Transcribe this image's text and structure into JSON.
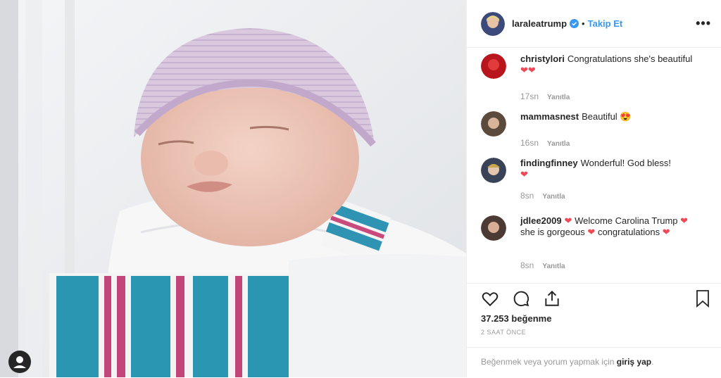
{
  "post": {
    "username": "laraleatrump",
    "follow_label": "Takip Et",
    "dot": "•",
    "likes": "37.253 beğenme",
    "time_ago": "2 SAAT ÖNCE",
    "login_text": "Beğenmek veya yorum yapmak için",
    "login_link": "giriş yap",
    "login_end": "."
  },
  "comments": [
    {
      "user": "christylori",
      "text": "Congratulations she's beautiful",
      "hearts": "❤❤",
      "time": "17sn",
      "reply": "Yanıtla"
    },
    {
      "user": "mammasnest",
      "text": "Beautiful",
      "hearts": "😍",
      "time": "16sn",
      "reply": "Yanıtla"
    },
    {
      "user": "findingfinney",
      "text": "Wonderful! God bless!",
      "hearts": "❤",
      "time": "8sn",
      "reply": "Yanıtla"
    },
    {
      "user": "jdlee2009",
      "text1": "❤",
      "text2": "Welcome Carolina Trump",
      "text3": "❤",
      "text4": "she is gorgeous",
      "text5": "❤",
      "text6": "congratulations",
      "text7": "❤",
      "time": "8sn",
      "reply": "Yanıtla"
    }
  ],
  "colors": {
    "accent": "#3897f0",
    "heart": "#ed4956",
    "text": "#262626",
    "muted": "#999999"
  },
  "icons": [
    "heart-icon",
    "comment-icon",
    "share-icon",
    "bookmark-icon",
    "verified-icon",
    "more-icon"
  ]
}
